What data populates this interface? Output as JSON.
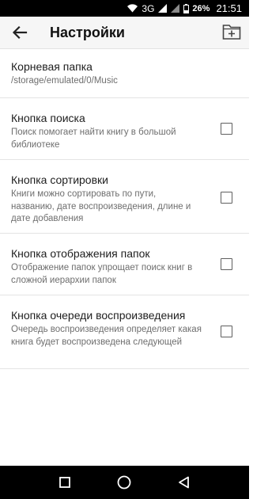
{
  "status_bar": {
    "network": "3G",
    "battery": "26%",
    "time": "21:51"
  },
  "app_bar": {
    "title": "Настройки"
  },
  "settings": [
    {
      "title": "Корневая папка",
      "description": "/storage/emulated/0/Music",
      "has_checkbox": false
    },
    {
      "title": "Кнопка поиска",
      "description": "Поиск помогает найти книгу в большой библиотеке",
      "has_checkbox": true,
      "checked": false
    },
    {
      "title": "Кнопка сортировки",
      "description": "Книги можно сортировать по пути, названию, дате воспроизведения, длине и дате добавления",
      "has_checkbox": true,
      "checked": false
    },
    {
      "title": "Кнопка отображения папок",
      "description": "Отображение папок упрощает поиск книг в сложной иерархии папок",
      "has_checkbox": true,
      "checked": false
    },
    {
      "title": "Кнопка очереди воспроизведения",
      "description": "Очередь воспроизведения определяет какая книга будет воспроизведена следующей",
      "has_checkbox": true,
      "checked": false
    }
  ]
}
